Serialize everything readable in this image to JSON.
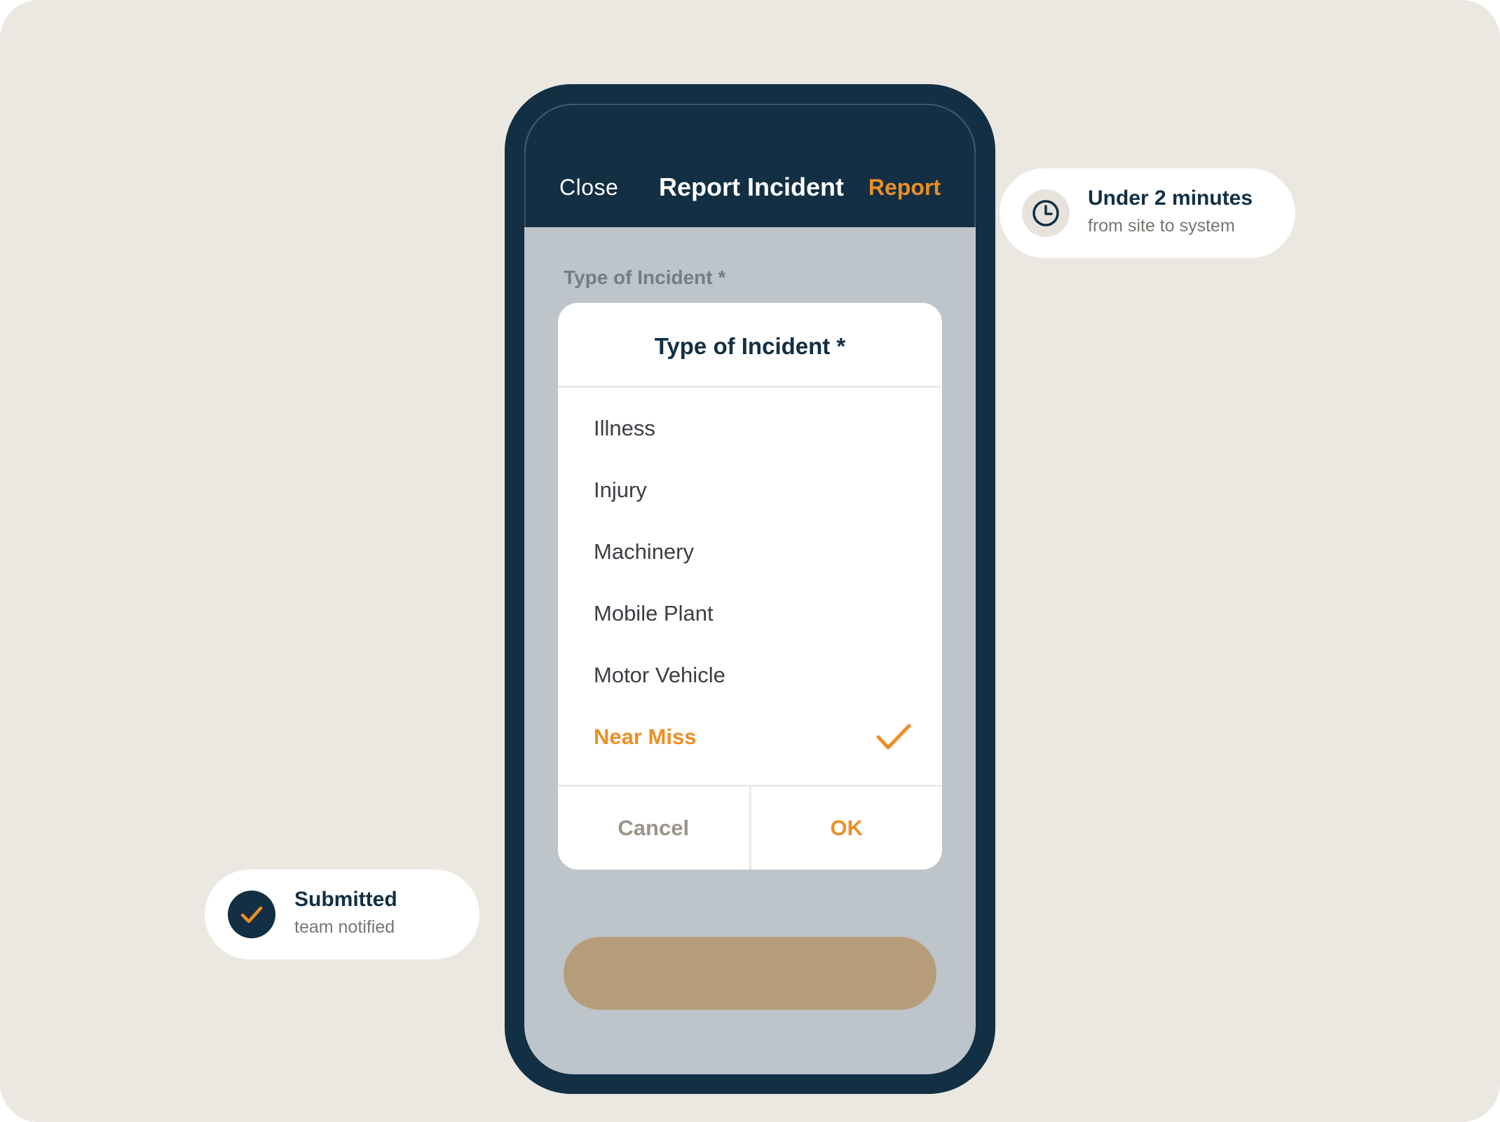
{
  "header": {
    "close_label": "Close",
    "title": "Report Incident",
    "report_label": "Report"
  },
  "form": {
    "field_label": "Type of Incident *"
  },
  "picker": {
    "title": "Type of Incident *",
    "options": [
      {
        "label": "Illness",
        "selected": false
      },
      {
        "label": "Injury",
        "selected": false
      },
      {
        "label": "Machinery",
        "selected": false
      },
      {
        "label": "Mobile Plant",
        "selected": false
      },
      {
        "label": "Motor Vehicle",
        "selected": false
      },
      {
        "label": "Near Miss",
        "selected": true
      }
    ],
    "cancel_label": "Cancel",
    "ok_label": "OK"
  },
  "badges": {
    "time": {
      "title": "Under 2 minutes",
      "subtitle": "from site to system",
      "icon": "clock-icon"
    },
    "submitted": {
      "title": "Submitted",
      "subtitle": "team notified",
      "icon": "check-icon"
    }
  },
  "colors": {
    "navy": "#122f44",
    "accent_orange": "#ed8e24",
    "background": "#ebe8e1",
    "screen_gray": "#bdc4ca",
    "submit_tan": "#b69d79"
  }
}
